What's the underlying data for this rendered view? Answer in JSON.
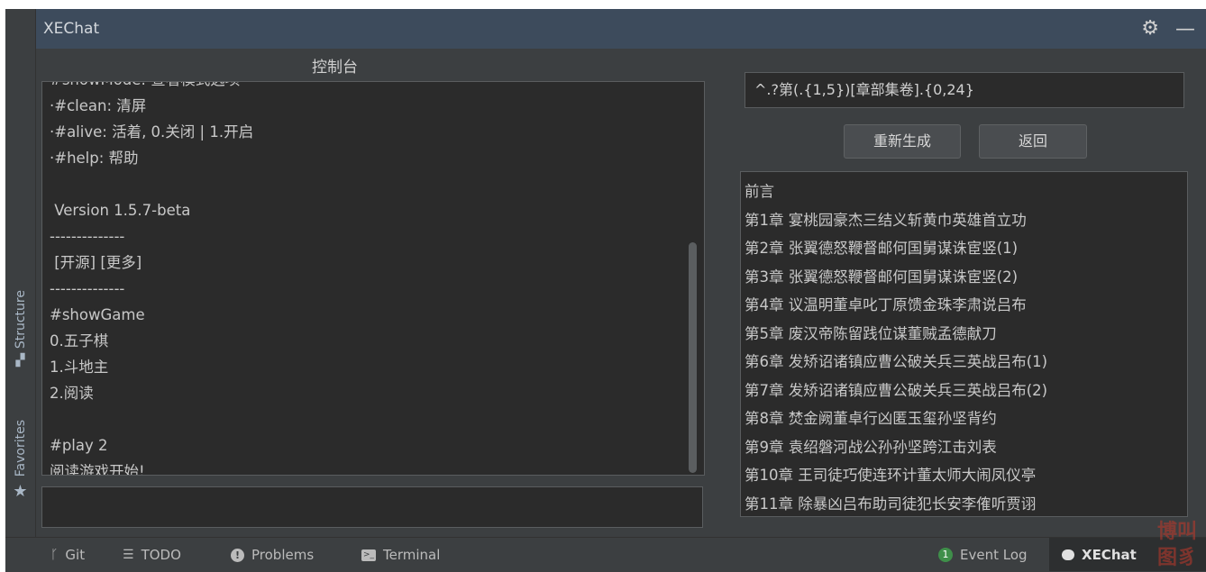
{
  "window": {
    "title": "XEChat"
  },
  "left_strip": {
    "structure_label": "Structure",
    "structure_icon": "structure-icon",
    "favorites_label": "Favorites",
    "favorites_icon": "star-icon"
  },
  "console": {
    "label": "控制台",
    "lines": [
      "#showMode: 查看模式选项",
      "·#clean: 清屏",
      "·#alive: 活着, 0.关闭 | 1.开启",
      "·#help: 帮助",
      "",
      " Version 1.5.7-beta",
      "--------------",
      " [开源] [更多]",
      "--------------",
      "#showGame",
      "0.五子棋",
      "1.斗地主",
      "2.阅读",
      "",
      "#play 2",
      "阅读游戏开始!"
    ],
    "input_value": ""
  },
  "reader": {
    "regex_value": "^.?第(.{1,5})[章部集卷].{0,24}",
    "regenerate_label": "重新生成",
    "back_label": "返回",
    "chapters": [
      "前言",
      "第1章 宴桃园豪杰三结义斩黄巾英雄首立功",
      "第2章 张翼德怒鞭督邮何国舅谋诛宦竖(1)",
      "第3章 张翼德怒鞭督邮何国舅谋诛宦竖(2)",
      "第4章 议温明董卓叱丁原馈金珠李肃说吕布",
      "第5章 废汉帝陈留践位谋董贼孟德献刀",
      "第6章 发矫诏诸镇应曹公破关兵三英战吕布(1)",
      "第7章 发矫诏诸镇应曹公破关兵三英战吕布(2)",
      "第8章 焚金阙董卓行凶匿玉玺孙坚背约",
      "第9章 袁绍磐河战公孙孙坚跨江击刘表",
      "第10章 王司徒巧使连环计董太师大闹凤仪亭",
      "第11章 除暴凶吕布助司徒犯长安李傕听贾诩"
    ]
  },
  "statusbar": {
    "git": "Git",
    "todo": "TODO",
    "problems": "Problems",
    "terminal": "Terminal",
    "event_log": "Event Log",
    "event_log_count": "1",
    "xechat": "XEChat"
  },
  "watermark": {
    "chars": [
      "博",
      "叫",
      "图",
      "豸"
    ]
  }
}
